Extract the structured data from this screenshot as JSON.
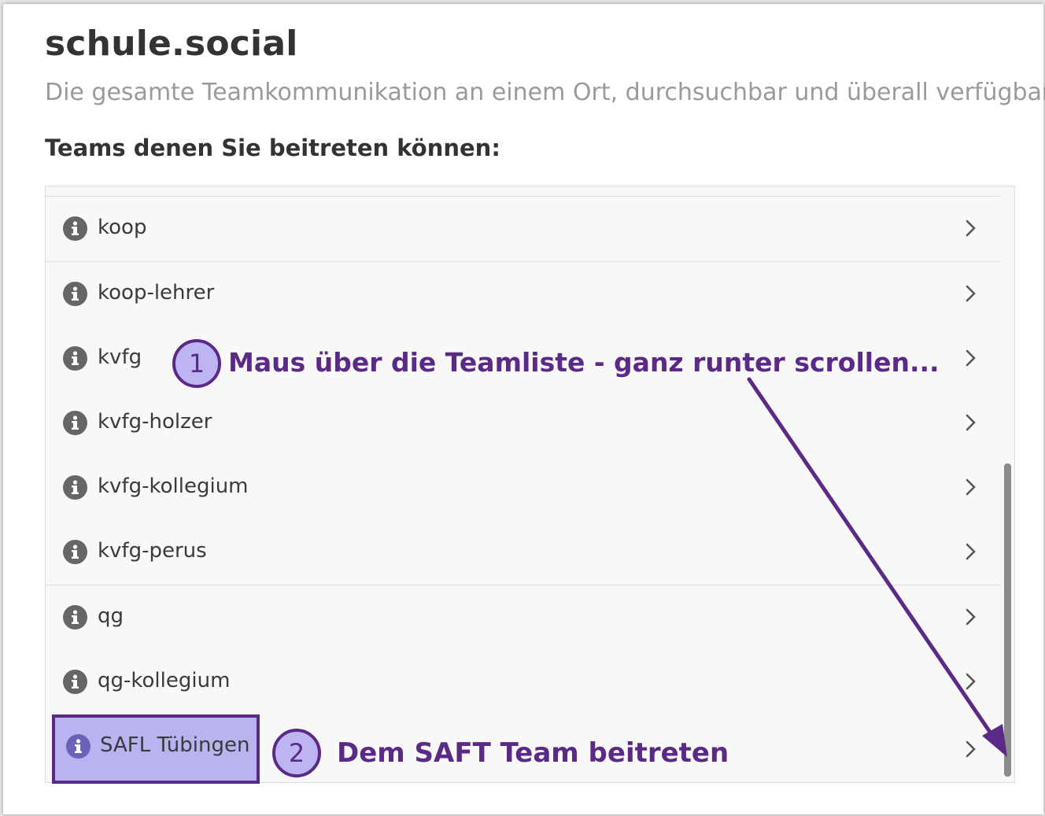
{
  "app": {
    "title": "schule.social",
    "subtitle": "Die gesamte Teamkommunikation an einem Ort, durchsuchbar und überall verfügbar"
  },
  "teams_section": {
    "heading": "Teams denen Sie beitreten können:",
    "items": [
      {
        "label": "koop",
        "icon": "info-icon"
      },
      {
        "label": "koop-lehrer",
        "icon": "info-icon"
      },
      {
        "label": "kvfg",
        "icon": "info-icon"
      },
      {
        "label": "kvfg-holzer",
        "icon": "info-icon"
      },
      {
        "label": "kvfg-kollegium",
        "icon": "info-icon"
      },
      {
        "label": "kvfg-perus",
        "icon": "info-icon"
      },
      {
        "label": "qg",
        "icon": "info-icon"
      },
      {
        "label": "qg-kollegium",
        "icon": "info-icon"
      },
      {
        "label": "SAFL Tübingen",
        "icon": "info-icon",
        "highlighted": true
      }
    ]
  },
  "annotations": {
    "step1": {
      "number": "1",
      "text": "Maus über die Teamliste - ganz runter scrollen..."
    },
    "step2": {
      "number": "2",
      "text": "Dem SAFT Team beitreten"
    },
    "color": "#5b2a86",
    "badge_fill": "#bdb5f2",
    "highlight_fill": "#b9b3f0"
  }
}
